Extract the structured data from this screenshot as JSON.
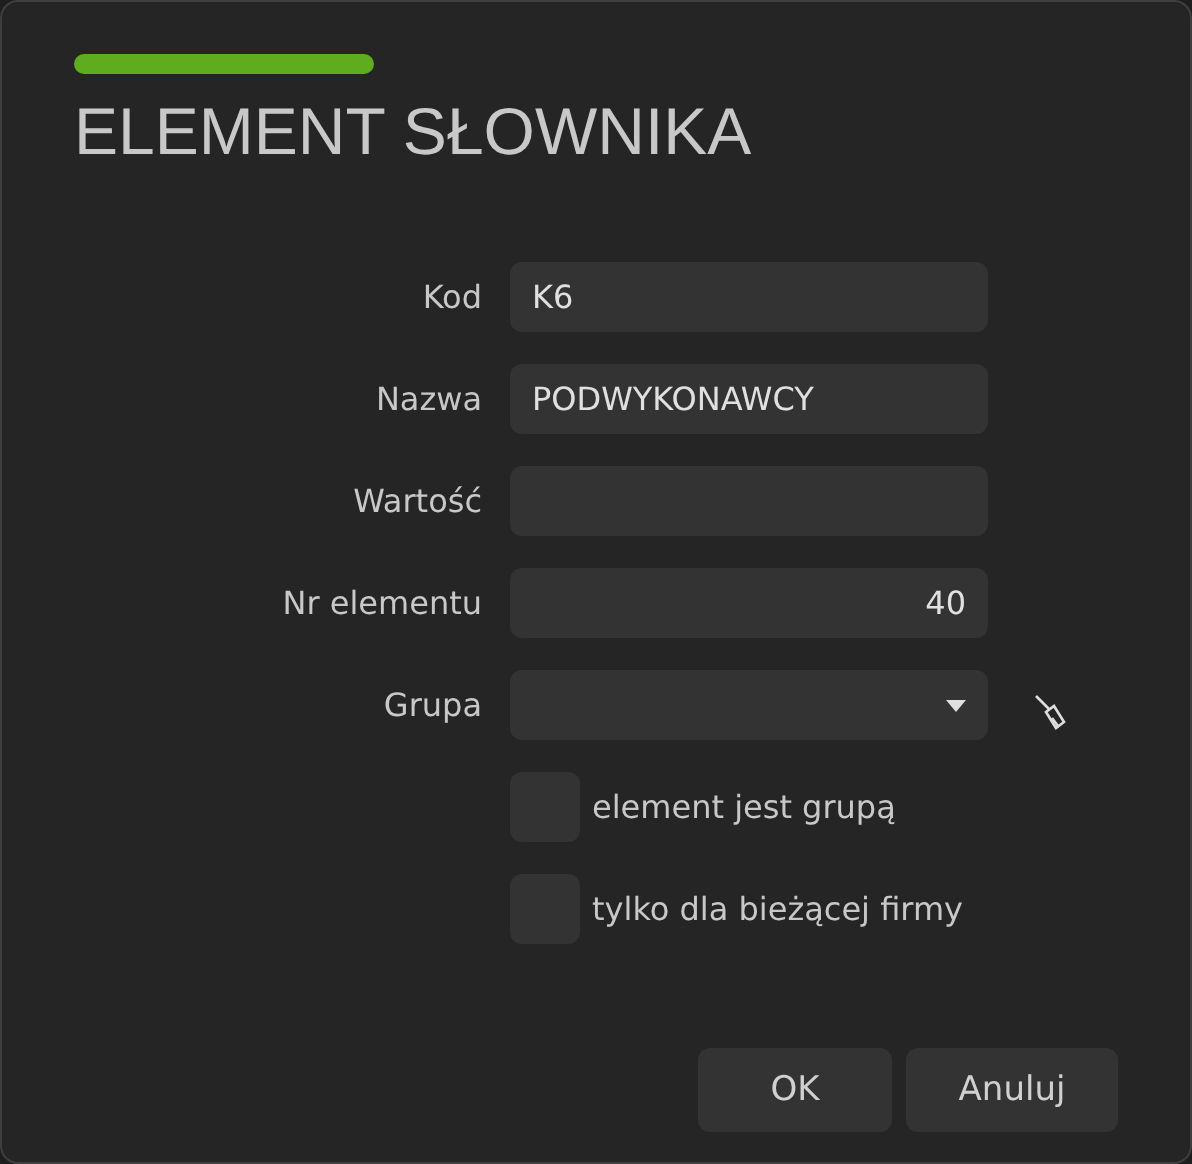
{
  "dialog": {
    "title": "ELEMENT SŁOWNIKA"
  },
  "fields": [
    {
      "kind": "text",
      "label": "Kod",
      "value": "K6"
    },
    {
      "kind": "text",
      "label": "Nazwa",
      "value": "PODWYKONAWCY"
    },
    {
      "kind": "text",
      "label": "Wartość"
    },
    {
      "kind": "number",
      "label": "Nr elementu",
      "value": "40"
    },
    {
      "kind": "select",
      "label": "Grupa"
    }
  ],
  "checkboxes": [
    {
      "label": "element jest grupą",
      "checked": false
    },
    {
      "label": "tylko dla bieżącej firmy",
      "checked": false
    }
  ],
  "buttons": [
    "OK",
    "Anuluj"
  ]
}
